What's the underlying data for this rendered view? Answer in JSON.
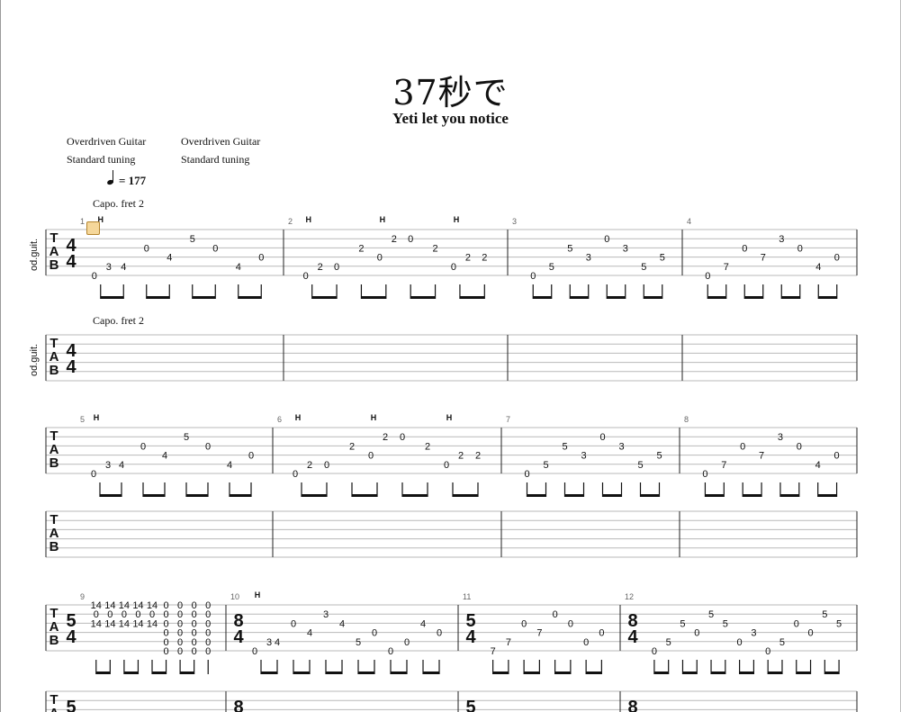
{
  "song": {
    "title": "37秒で",
    "artist": "Yeti let you notice"
  },
  "tracks": [
    {
      "instrument": "Overdriven Guitar",
      "tuning": "Standard tuning"
    },
    {
      "instrument": "Overdriven Guitar",
      "tuning": "Standard tuning"
    }
  ],
  "tempo": {
    "equals": "= 177"
  },
  "capo": "Capo. fret 2",
  "track_label": "od.guit.",
  "tab_letters": [
    "T",
    "A",
    "B"
  ],
  "systems": [
    {
      "measures": [
        {
          "n": "1",
          "ts": [
            "4",
            "4"
          ],
          "h": [
            "H"
          ],
          "notes": [
            [
              "0",
              "3"
            ],
            [
              "4"
            ],
            [
              "0"
            ],
            [
              "4"
            ],
            [
              "5"
            ],
            [
              "0"
            ],
            [
              "4"
            ],
            [
              "0"
            ]
          ]
        },
        {
          "n": "2",
          "h": [
            "H",
            "H",
            "H"
          ],
          "notes": [
            [
              "0",
              "2"
            ],
            [
              "0"
            ],
            [
              "2"
            ],
            [
              "0",
              "2"
            ],
            [
              "0"
            ],
            [
              "2"
            ],
            [
              "0",
              "2"
            ],
            [
              "2"
            ]
          ]
        },
        {
          "n": "3",
          "notes": [
            [
              "0"
            ],
            [
              "5"
            ],
            [
              "5"
            ],
            [
              "3"
            ],
            [
              "0"
            ],
            [
              "3"
            ],
            [
              "5"
            ],
            [
              "5"
            ]
          ]
        },
        {
          "n": "4",
          "notes": [
            [
              "0"
            ],
            [
              "7"
            ],
            [
              "0"
            ],
            [
              "7"
            ],
            [
              "3"
            ],
            [
              "0"
            ],
            [
              "4"
            ],
            [
              "0"
            ]
          ]
        }
      ]
    },
    {
      "measures": [
        {
          "n": "5",
          "h": [
            "H"
          ],
          "notes": [
            [
              "0",
              "3"
            ],
            [
              "4"
            ],
            [
              "0"
            ],
            [
              "4"
            ],
            [
              "5"
            ],
            [
              "0"
            ],
            [
              "4"
            ],
            [
              "0"
            ]
          ]
        },
        {
          "n": "6",
          "h": [
            "H",
            "H",
            "H"
          ],
          "notes": [
            [
              "0",
              "2"
            ],
            [
              "0"
            ],
            [
              "2"
            ],
            [
              "0",
              "2"
            ],
            [
              "0"
            ],
            [
              "2"
            ],
            [
              "0",
              "2"
            ],
            [
              "2"
            ]
          ]
        },
        {
          "n": "7",
          "notes": [
            [
              "0"
            ],
            [
              "5"
            ],
            [
              "5"
            ],
            [
              "3"
            ],
            [
              "0"
            ],
            [
              "3"
            ],
            [
              "5"
            ],
            [
              "5"
            ]
          ]
        },
        {
          "n": "8",
          "notes": [
            [
              "0"
            ],
            [
              "7"
            ],
            [
              "0"
            ],
            [
              "7"
            ],
            [
              "3"
            ],
            [
              "0"
            ],
            [
              "4"
            ],
            [
              "0"
            ]
          ]
        }
      ]
    },
    {
      "measures": [
        {
          "n": "9",
          "ts": [
            "5",
            "4"
          ],
          "chords": [
            [
              "14",
              "0",
              "14"
            ],
            [
              "14",
              "0",
              "14"
            ],
            [
              "14",
              "0",
              "14"
            ],
            [
              "14",
              "0",
              "14"
            ],
            [
              "14",
              "0",
              "14"
            ],
            [
              "0",
              "0",
              "0",
              "0",
              "0",
              "0"
            ],
            [
              "0",
              "0",
              "0",
              "0",
              "0",
              "0"
            ],
            [
              "0",
              "0",
              "0",
              "0",
              "0",
              "0"
            ],
            [
              "0",
              "0",
              "0",
              "0",
              "0",
              "0"
            ]
          ]
        },
        {
          "n": "10",
          "ts": [
            "8",
            "4"
          ],
          "h": [
            "H"
          ],
          "notes": [
            [
              "0",
              "3"
            ],
            [
              "4"
            ],
            [
              "0"
            ],
            [
              "4"
            ],
            [
              "3"
            ],
            [
              "4"
            ],
            [
              "5"
            ],
            [
              "0"
            ],
            [
              "0"
            ],
            [
              "0"
            ],
            [
              "4"
            ],
            [
              "0"
            ]
          ]
        },
        {
          "n": "11",
          "ts": [
            "5",
            "4"
          ],
          "notes": [
            [
              "7"
            ],
            [
              "7"
            ],
            [
              "0"
            ],
            [
              "7"
            ],
            [
              "0"
            ],
            [
              "0"
            ],
            [
              "0"
            ],
            [
              "0"
            ]
          ]
        },
        {
          "n": "12",
          "ts": [
            "8",
            "4"
          ],
          "notes": [
            [
              "0"
            ],
            [
              "5"
            ],
            [
              "5"
            ],
            [
              "0"
            ],
            [
              "5"
            ],
            [
              "5"
            ],
            [
              "0"
            ],
            [
              "3"
            ],
            [
              "0"
            ],
            [
              "5"
            ],
            [
              "0"
            ],
            [
              "0"
            ],
            [
              "5"
            ],
            [
              "5"
            ]
          ]
        }
      ]
    }
  ]
}
